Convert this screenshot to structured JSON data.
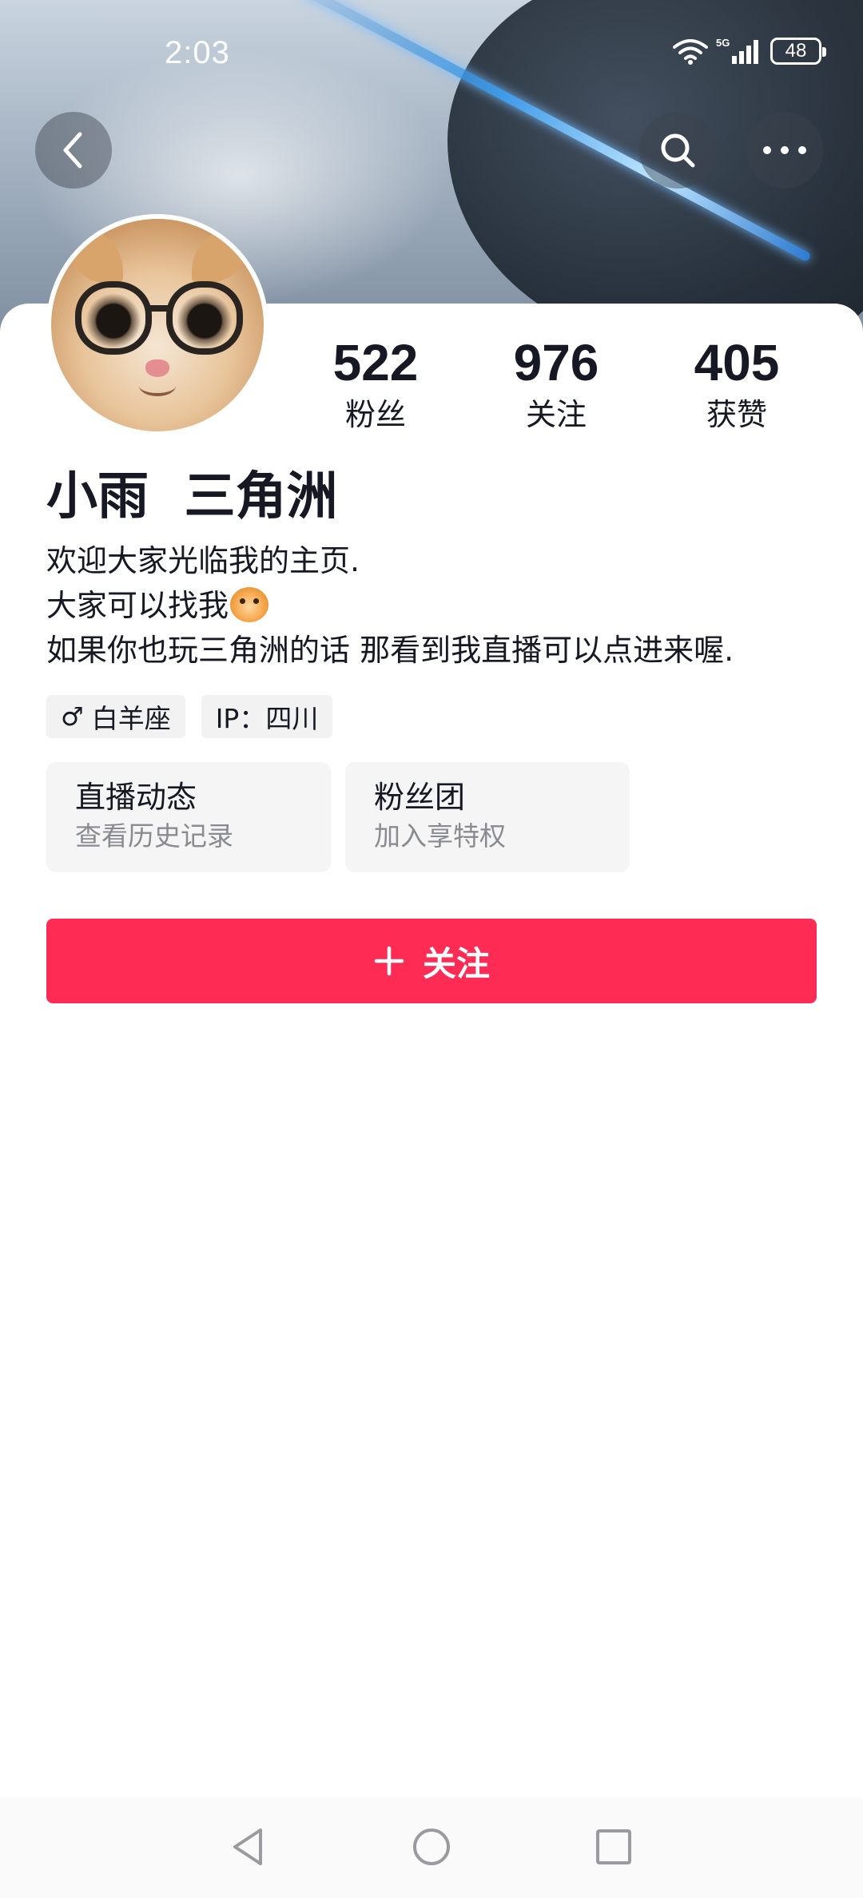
{
  "status_bar": {
    "time": "2:03",
    "network": "5G",
    "battery": "48"
  },
  "header": {
    "back_icon": "chevron-left-icon",
    "search_icon": "search-icon",
    "more_icon": "more-horizontal-icon"
  },
  "profile": {
    "stats": [
      {
        "value": "522",
        "label": "粉丝"
      },
      {
        "value": "976",
        "label": "关注"
      },
      {
        "value": "405",
        "label": "获赞"
      }
    ],
    "nickname": "小雨  三角洲",
    "bio": [
      "欢迎大家光临我的主页.",
      "大家可以找我",
      "如果你也玩三角洲的话 那看到我直播可以点进来喔."
    ],
    "tags": [
      {
        "icon": "male-icon",
        "text": "白羊座"
      },
      {
        "text": "IP：四川"
      }
    ],
    "entries": [
      {
        "title": "直播动态",
        "subtitle": "查看历史记录"
      },
      {
        "title": "粉丝团",
        "subtitle": "加入享特权"
      }
    ],
    "follow_button": {
      "icon": "plus-icon",
      "label": "关注"
    }
  },
  "colors": {
    "accent": "#fe2c55",
    "text_primary": "#161823",
    "text_secondary": "#8a8b91",
    "chip_background": "#f2f2f3"
  },
  "nav_bar": {
    "icons": [
      "nav-back-icon",
      "nav-home-icon",
      "nav-recents-icon"
    ]
  }
}
